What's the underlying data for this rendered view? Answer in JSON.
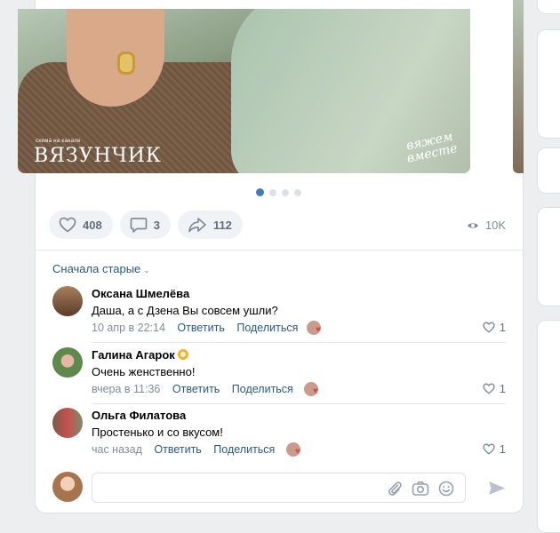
{
  "post": {
    "image": {
      "brand_small": "схема на канале",
      "brand_main": "ВЯЗУНЧИК",
      "signature_line1": "вяжем",
      "signature_line2": "вместе"
    },
    "carousel": {
      "total": 4,
      "active_index": 0
    },
    "likes": "408",
    "comments": "3",
    "shares": "112",
    "views": "10K"
  },
  "comments_sort": "Сначала старые",
  "comments": [
    {
      "author": "Оксана Шмелёва",
      "text": "Даша, а с Дзена Вы совсем ушли?",
      "time": "10 апр в 22:14",
      "reply_label": "Ответить",
      "share_label": "Поделиться",
      "likes": "1",
      "has_badge": false
    },
    {
      "author": "Галина Агарок",
      "text": "Очень женственно!",
      "time": "вчера в 11:36",
      "reply_label": "Ответить",
      "share_label": "Поделиться",
      "likes": "1",
      "has_badge": true
    },
    {
      "author": "Ольга Филатова",
      "text": "Простенько и со вкусом!",
      "time": "час назад",
      "reply_label": "Ответить",
      "share_label": "Поделиться",
      "likes": "1",
      "has_badge": false
    }
  ],
  "composer": {
    "icons": [
      "paperclip-icon",
      "camera-icon",
      "smile-icon",
      "send-icon"
    ]
  },
  "colors": {
    "accent": "#447bba",
    "link": "#2a5885",
    "muted": "#818c99",
    "heart": "#e64646",
    "badge": "#f5b12a"
  }
}
